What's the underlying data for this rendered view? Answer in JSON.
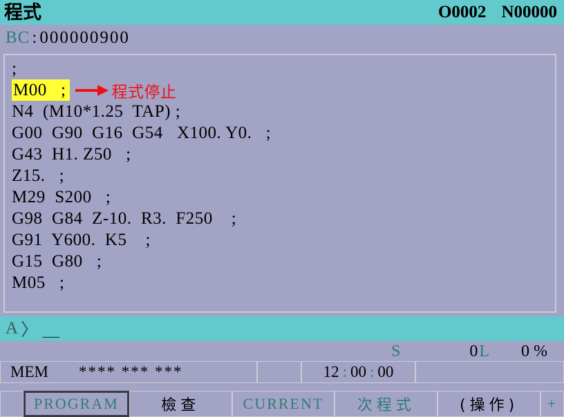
{
  "header": {
    "title": "程式",
    "program_number": "O0002",
    "sequence_number": "N00000"
  },
  "bc_line": {
    "label": "BC",
    "separator": ":",
    "value": "000000900"
  },
  "program": {
    "lines": [
      {
        "text": ";",
        "highlight": false
      },
      {
        "text": "M00   ;",
        "highlight": true,
        "annotation": "程式停止"
      },
      {
        "text": "N4  (M10*1.25  TAP) ;",
        "highlight": false
      },
      {
        "text": "G00  G90  G16  G54   X100. Y0.   ;",
        "highlight": false
      },
      {
        "text": "G43  H1. Z50   ;",
        "highlight": false
      },
      {
        "text": "Z15.   ;",
        "highlight": false
      },
      {
        "text": "M29  S200   ;",
        "highlight": false
      },
      {
        "text": "G98  G84  Z-10.  R3.  F250    ;",
        "highlight": false
      },
      {
        "text": "G91  Y600.  K5    ;",
        "highlight": false
      },
      {
        "text": "G15  G80   ;",
        "highlight": false
      },
      {
        "text": "M05   ;",
        "highlight": false
      }
    ]
  },
  "prompt": {
    "label": "A",
    "caret": "〉",
    "cursor": "＿"
  },
  "status": {
    "spindle_label": "S",
    "spindle_value": "0",
    "load_label": "L",
    "override_value": "0 %"
  },
  "mode_row": {
    "mode": "MEM",
    "alarm_status": "**** *** ***",
    "time_hours": "12",
    "time_minutes": "00",
    "time_seconds": "00",
    "time_separator": ":"
  },
  "softkeys": [
    {
      "label": "",
      "name": "softkey-left-edge",
      "style": "edge",
      "selected": false
    },
    {
      "label": "PROGRAM",
      "name": "softkey-program",
      "style": "teal",
      "selected": true
    },
    {
      "label": "檢查",
      "name": "softkey-check",
      "style": "black-cjk",
      "selected": false
    },
    {
      "label": "CURRENT",
      "name": "softkey-current",
      "style": "teal",
      "selected": false
    },
    {
      "label": "次程式",
      "name": "softkey-next-program",
      "style": "teal-cjk",
      "selected": false
    },
    {
      "label": "(操作)",
      "name": "softkey-operation",
      "style": "black-cjk",
      "selected": false
    },
    {
      "label": "+",
      "name": "softkey-more",
      "style": "edge-last",
      "selected": false
    }
  ],
  "colors": {
    "background": "#a3a3c6",
    "accent_teal": "#62c9cc",
    "text_teal": "#2f7d74",
    "highlight_yellow": "#ffff33",
    "annotation_red": "#ee1111",
    "border": "#ccccd8"
  }
}
